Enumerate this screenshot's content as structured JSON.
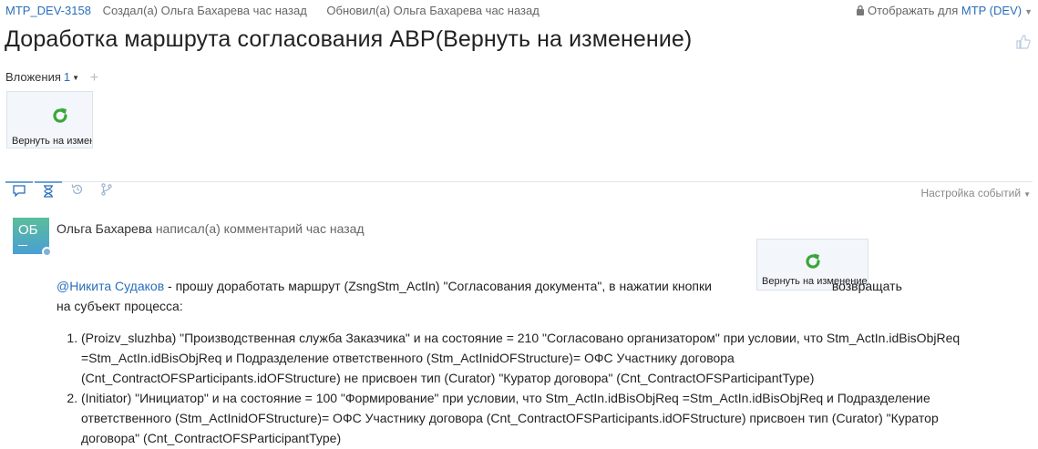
{
  "issue": {
    "key": "MTP_DEV-3158",
    "created": "Создал(а) Ольга Бахарева час назад",
    "updated": "Обновил(а) Ольга Бахарева час назад",
    "visibility_label": "Отображать для",
    "visibility_project": "MTP (DEV)",
    "title": "Доработка маршрута согласования АВР(Вернуть на изменение)"
  },
  "attachments": {
    "label": "Вложения",
    "count": "1",
    "thumb_label": "Вернуть на измен"
  },
  "activity": {
    "tabs": [
      "comments-icon",
      "hourglass-icon",
      "history-icon",
      "branch-icon"
    ],
    "settings_label": "Настройка событий"
  },
  "comment": {
    "avatar_initials": "ОБ",
    "author": "Ольга Бахарева",
    "action": "написал(а) комментарий час назад",
    "mention": "@Никита Судаков",
    "text_before": "- прошу доработать маршрут (ZsngStm_ActIn) \"Согласования документа\", в нажатии кнопки",
    "button_label": "Вернуть на изменение",
    "text_after": "возвращать",
    "text_line2": "на субъект процесса:",
    "items": [
      "(Proizv_sluzhba) \"Производственная служба Заказчика\" и на состояние = 210 \"Согласовано организатором\" при условии, что Stm_ActIn.idBisObjReq =Stm_ActIn.idBisObjReq и Подразделение ответственного (Stm_ActInidOFStructure)= ОФС Участнику договора (Cnt_ContractOFSParticipants.idOFStructure) не присвоен тип (Curator) \"Куратор договора\" (Cnt_ContractOFSParticipantType)",
      "(Initiator) \"Инициатор\" и на состояние = 100 \"Формирование\" при условии, что Stm_ActIn.idBisObjReq =Stm_ActIn.idBisObjReq и Подразделение ответственного (Stm_ActInidOFStructure)= ОФС Участнику договора (Cnt_ContractOFSParticipants.idOFStructure) присвоен тип (Curator) \"Куратор договора\" (Cnt_ContractOFSParticipantType)"
    ]
  },
  "colors": {
    "link": "#2a6ebb",
    "refresh_icon": "#3aa63a"
  }
}
